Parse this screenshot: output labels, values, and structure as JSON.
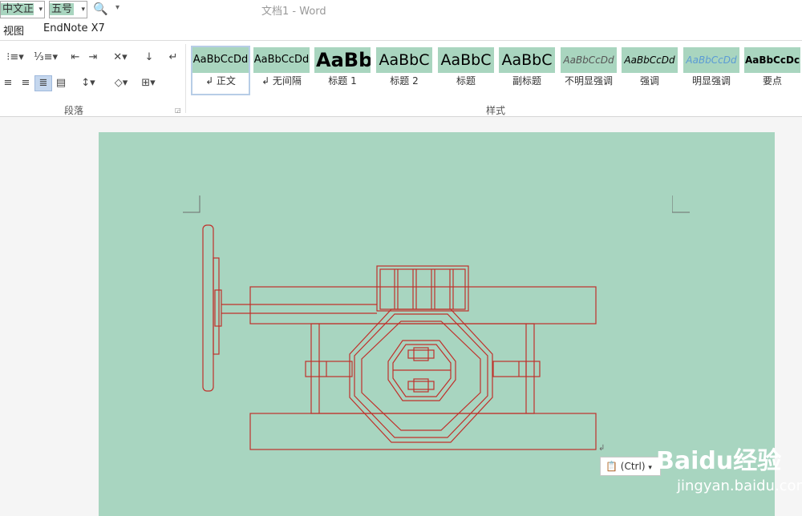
{
  "titlebar": {
    "font_name": "中文正文",
    "font_size": "五号",
    "title": "文档1 - Word"
  },
  "menu": {
    "view": "视图",
    "endnote": "EndNote X7"
  },
  "ribbon": {
    "paragraph_group": "段落",
    "styles_group": "样式",
    "styles": [
      {
        "sample": "AaBbCcDd",
        "name": "↲ 正文"
      },
      {
        "sample": "AaBbCcDd",
        "name": "↲ 无间隔"
      },
      {
        "sample": "AaBb",
        "name": "标题 1"
      },
      {
        "sample": "AaBbC",
        "name": "标题 2"
      },
      {
        "sample": "AaBbC",
        "name": "标题"
      },
      {
        "sample": "AaBbC",
        "name": "副标题"
      },
      {
        "sample": "AaBbCcDd",
        "name": "不明显强调"
      },
      {
        "sample": "AaBbCcDd",
        "name": "强调"
      },
      {
        "sample": "AaBbCcDd",
        "name": "明显强调"
      },
      {
        "sample": "AaBbCcDc",
        "name": "要点"
      }
    ]
  },
  "document": {
    "paste_options": "(Ctrl)",
    "drawing_color": "#c0302a",
    "page_color": "#a8d5c0"
  },
  "watermark": {
    "brand": "Baidu经验",
    "url": "jingyan.baidu.com"
  }
}
